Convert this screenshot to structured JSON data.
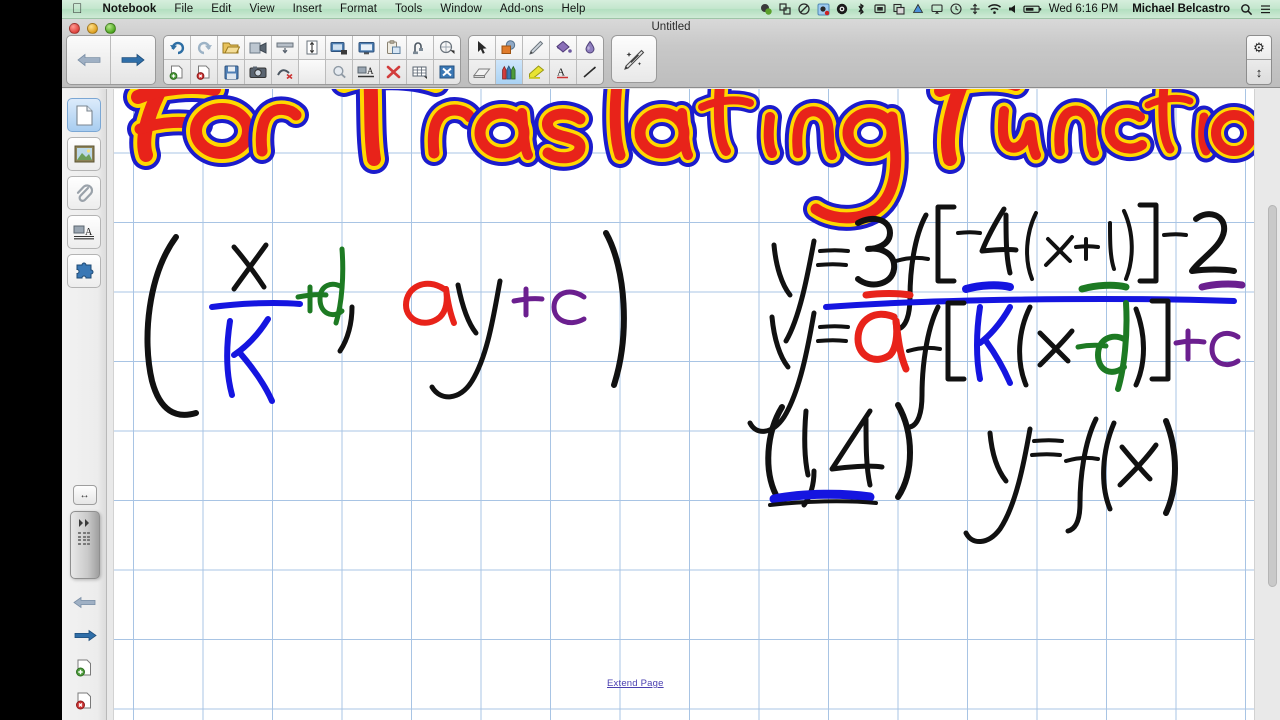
{
  "menubar": {
    "apple_icon": "apple-logo",
    "items": [
      {
        "label": "Notebook",
        "bold": true
      },
      {
        "label": "File",
        "bold": false
      },
      {
        "label": "Edit",
        "bold": false
      },
      {
        "label": "View",
        "bold": false
      },
      {
        "label": "Insert",
        "bold": false
      },
      {
        "label": "Format",
        "bold": false
      },
      {
        "label": "Tools",
        "bold": false
      },
      {
        "label": "Window",
        "bold": false
      },
      {
        "label": "Add-ons",
        "bold": false
      },
      {
        "label": "Help",
        "bold": false
      }
    ],
    "status_icons": [
      "colorsync-icon",
      "screen-share-icon",
      "do-not-disturb-icon",
      "app-badge-icon",
      "dropbox-icon",
      "bluetooth-icon",
      "display-icon",
      "copy-icon",
      "google-drive-icon",
      "airplay-icon",
      "time-machine-icon",
      "sync-icon",
      "wifi-icon",
      "volume-icon",
      "battery-icon"
    ],
    "clock": "Wed 6:16 PM",
    "user": "Michael Belcastro",
    "search_icon": "search-icon",
    "notification_icon": "notification-center-icon"
  },
  "window": {
    "title": "Untitled",
    "traffic_lights": [
      "close-button",
      "minimize-button",
      "zoom-button"
    ]
  },
  "toolbar": {
    "nav": [
      {
        "name": "previous-page-button",
        "icon": "left-arrow-icon"
      },
      {
        "name": "next-page-button",
        "icon": "right-arrow-icon"
      }
    ],
    "groups": [
      {
        "columns": [
          {
            "top": {
              "name": "undo-button",
              "icon": "undo-icon"
            },
            "bottom": {
              "name": "add-page-button",
              "icon": "page-add-icon"
            }
          },
          {
            "top": {
              "name": "redo-button",
              "icon": "redo-icon"
            },
            "bottom": {
              "name": "delete-page-button",
              "icon": "page-delete-icon"
            }
          },
          {
            "top": {
              "name": "open-button",
              "icon": "folder-open-icon"
            },
            "bottom": {
              "name": "save-button",
              "icon": "floppy-save-icon"
            }
          },
          {
            "top": {
              "name": "insert-media-button",
              "icon": "media-icon"
            },
            "bottom": {
              "name": "screen-capture-button",
              "icon": "camera-icon"
            }
          },
          {
            "top": {
              "name": "screen-shade-button",
              "icon": "shade-icon"
            },
            "bottom": {
              "name": "clear-ink-button",
              "icon": "clear-ink-icon"
            }
          },
          {
            "top": {
              "name": "full-page-button",
              "icon": "fit-page-icon"
            },
            "bottom": {
              "name": "spacer",
              "icon": ""
            }
          },
          {
            "top": {
              "name": "dual-page-button",
              "icon": "dual-display-icon"
            },
            "bottom": {
              "name": "magnifier-button",
              "icon": "magnifier-icon"
            }
          },
          {
            "top": {
              "name": "full-screen-button",
              "icon": "fullscreen-icon"
            },
            "bottom": {
              "name": "text-properties-button",
              "icon": "text-format-icon"
            }
          },
          {
            "top": {
              "name": "paste-button",
              "icon": "clipboard-icon"
            },
            "bottom": {
              "name": "delete-button",
              "icon": "red-x-icon"
            }
          },
          {
            "top": {
              "name": "measurement-tool-button",
              "icon": "measure-icon"
            },
            "bottom": {
              "name": "table-button",
              "icon": "table-icon"
            }
          },
          {
            "top": {
              "name": "gesture-button",
              "icon": "gesture-icon"
            },
            "bottom": {
              "name": "close-tool-button",
              "icon": "blue-x-icon"
            }
          }
        ]
      },
      {
        "columns": [
          {
            "top": {
              "name": "select-tool",
              "icon": "pointer-icon"
            },
            "bottom": {
              "name": "eraser-tool",
              "icon": "eraser-icon"
            }
          },
          {
            "top": {
              "name": "shapes-tool",
              "icon": "shapes-icon"
            },
            "bottom": {
              "name": "pens-tool",
              "icon": "pens-icon",
              "selected": true
            }
          },
          {
            "top": {
              "name": "pen-tool",
              "icon": "pen-icon"
            },
            "bottom": {
              "name": "highlighter-tool",
              "icon": "highlighter-icon"
            }
          },
          {
            "top": {
              "name": "fill-tool",
              "icon": "paint-bucket-icon"
            },
            "bottom": {
              "name": "text-tool",
              "icon": "text-a-icon"
            }
          },
          {
            "top": {
              "name": "color-tool",
              "icon": "ink-color-icon"
            },
            "bottom": {
              "name": "line-tool",
              "icon": "line-icon"
            }
          }
        ]
      }
    ],
    "magic_pen": {
      "name": "magic-pen-tool",
      "icon": "magic-pen-icon"
    },
    "right_controls": [
      {
        "name": "settings-button",
        "icon": "gear-icon",
        "glyph": "⚙"
      },
      {
        "name": "resize-toolbar-button",
        "icon": "vertical-resize-icon",
        "glyph": "↕"
      }
    ]
  },
  "sidebar": {
    "top_items": [
      {
        "name": "sidebar-page-sorter",
        "icon": "page-icon",
        "active": true
      },
      {
        "name": "sidebar-gallery",
        "icon": "gallery-image-icon",
        "active": false
      },
      {
        "name": "sidebar-attachments",
        "icon": "paperclip-icon",
        "active": false
      },
      {
        "name": "sidebar-properties",
        "icon": "text-properties-icon",
        "active": false
      },
      {
        "name": "sidebar-add-ons",
        "icon": "puzzle-piece-icon",
        "active": false
      }
    ],
    "bottom_items": [
      {
        "name": "sidebar-autohide-toggle",
        "icon": "horizontal-resize-icon",
        "glyph": "↔"
      },
      {
        "name": "sidebar-collapse-handle",
        "icon": "double-chevron-right-icon"
      },
      {
        "name": "sidebar-previous-button",
        "icon": "left-arrow-icon"
      },
      {
        "name": "sidebar-next-button",
        "icon": "right-arrow-icon"
      },
      {
        "name": "sidebar-add-page-button",
        "icon": "page-add-icon"
      },
      {
        "name": "sidebar-delete-page-button",
        "icon": "page-delete-icon"
      }
    ]
  },
  "canvas": {
    "extend_page_label": "Extend Page",
    "grid_color": "#a8c4e4",
    "page_background": "#ffffff",
    "handwriting": {
      "title": "For Translating Functions",
      "title_fill": "#e8231a",
      "title_outline_inner": "#ffd800",
      "title_outline_outer": "#1c1ccc",
      "ordered_pair": "( x/K + d , ay + c )",
      "ordered_pair_parts": [
        {
          "text": "(",
          "color": "#111111"
        },
        {
          "text": "x",
          "color": "#111111"
        },
        {
          "text": "K",
          "color": "#1515e0"
        },
        {
          "text": "fraction-bar",
          "color": "#1515e0"
        },
        {
          "text": "+d",
          "color": "#1d7a23"
        },
        {
          "text": ",",
          "color": "#111111"
        },
        {
          "text": "a",
          "color": "#e8231a"
        },
        {
          "text": "y",
          "color": "#111111"
        },
        {
          "text": "+c",
          "color": "#6b1f8f"
        },
        {
          "text": ")",
          "color": "#111111"
        }
      ],
      "equation_top": "y= 3f[-4(x+1)]-2",
      "equation_bottom": "y= a f[K(x-d)]+c",
      "equation_divider_color": "#1515e0",
      "marks": [
        {
          "over": "3",
          "color": "#e8231a"
        },
        {
          "over": "-4",
          "color": "#1515e0"
        },
        {
          "over": "+1",
          "color": "#1d7a23"
        },
        {
          "over": "-2",
          "color": "#6b1f8f"
        }
      ],
      "point": "(1, 4)",
      "point_underline_color": "#1515e0",
      "function_note": "y=f(x)"
    }
  }
}
